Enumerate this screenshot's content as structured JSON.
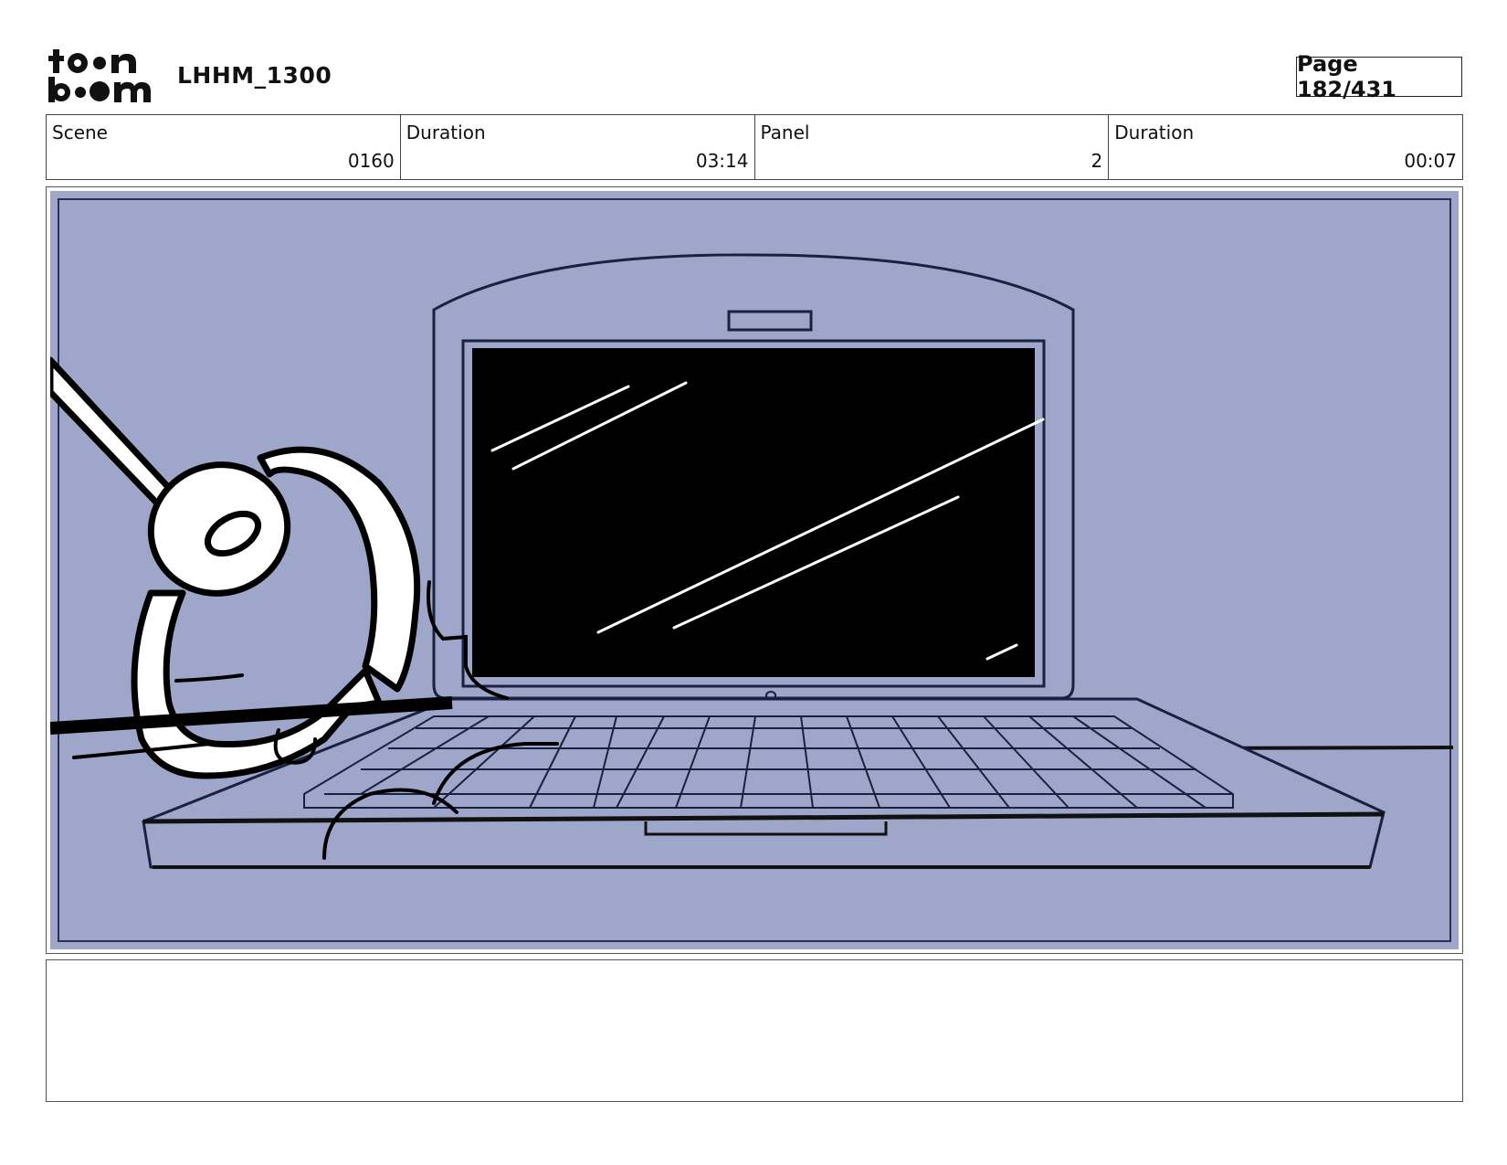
{
  "header": {
    "logo_text": "toon boom",
    "project_title": "LHHM_1300",
    "page_label": "Page 182/431"
  },
  "info": [
    {
      "label": "Scene",
      "value": "0160"
    },
    {
      "label": "Duration",
      "value": "03:14"
    },
    {
      "label": "Panel",
      "value": "2"
    },
    {
      "label": "Duration",
      "value": "00:07"
    }
  ],
  "panel": {
    "description_icon": "laptop-sketch",
    "background_color": "#9ea7c9",
    "line_color": "#1a2140"
  },
  "notes": {
    "text": ""
  }
}
